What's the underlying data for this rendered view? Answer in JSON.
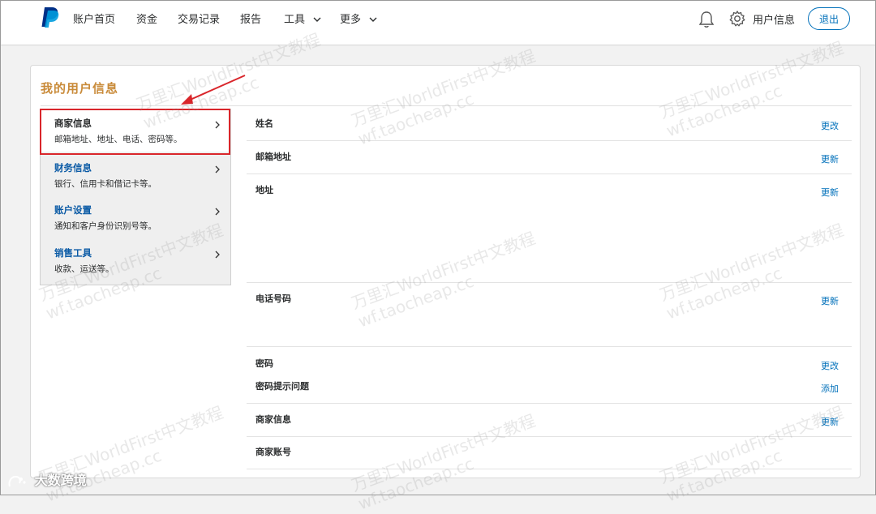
{
  "nav": {
    "items": [
      {
        "label": "账户首页"
      },
      {
        "label": "资金"
      },
      {
        "label": "交易记录"
      },
      {
        "label": "报告"
      },
      {
        "label": "工具"
      },
      {
        "label": "更多"
      }
    ],
    "user_label": "用户信息",
    "logout_label": "退出",
    "brand_color": "#003087",
    "accent_color": "#0070ba"
  },
  "page": {
    "title": "我的用户信息"
  },
  "sidebar": {
    "items": [
      {
        "title": "商家信息",
        "desc": "邮箱地址、地址、电话、密码等。"
      },
      {
        "title": "财务信息",
        "desc": "银行、信用卡和借记卡等。"
      },
      {
        "title": "账户设置",
        "desc": "通知和客户身份识别号等。"
      },
      {
        "title": "销售工具",
        "desc": "收款、运送等。"
      }
    ],
    "highlight_color": "#d9262b"
  },
  "content": {
    "rows": [
      {
        "label": "姓名",
        "action": "更改"
      },
      {
        "label": "邮箱地址",
        "action": "更新"
      },
      {
        "label": "地址",
        "action": "更新"
      },
      {
        "label": "电话号码",
        "action": "更新"
      },
      {
        "label": "密码",
        "action": "更改"
      },
      {
        "label": "密码提示问题",
        "action": "添加"
      },
      {
        "label": "商家信息",
        "action": "更新"
      },
      {
        "label": "商家账号",
        "action": ""
      }
    ]
  },
  "watermark": {
    "line1": "万里汇WorldFirst中文教程",
    "line2": "wf.taocheap.cc"
  },
  "brand_badge": {
    "label": "大数跨境"
  }
}
